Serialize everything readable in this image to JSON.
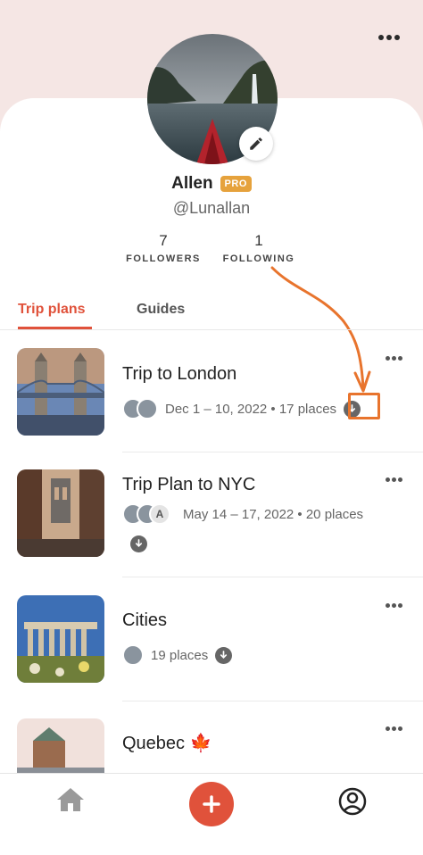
{
  "profile": {
    "name": "Allen",
    "badge": "PRO",
    "handle": "@Lunallan",
    "followers_count": "7",
    "followers_label": "FOLLOWERS",
    "following_count": "1",
    "following_label": "FOLLOWING"
  },
  "tabs": [
    {
      "label": "Trip plans",
      "active": true
    },
    {
      "label": "Guides",
      "active": false
    }
  ],
  "trips": [
    {
      "title": "Trip to London",
      "meta": "Dec 1 –  10, 2022 • 17 places"
    },
    {
      "title": "Trip Plan to NYC",
      "meta": "May 14 –  17, 2022 • 20 places",
      "avatar_letter": "A"
    },
    {
      "title": "Cities",
      "meta": "19 places"
    },
    {
      "title": "Quebec 🍁"
    }
  ],
  "colors": {
    "accent": "#e0523b",
    "pro_badge": "#e6a23c",
    "annotation": "#e8742d",
    "header_bg": "#f5e6e4"
  },
  "icons": [
    "more-horizontal-icon",
    "pencil-icon",
    "download-icon",
    "home-icon",
    "plus-icon",
    "profile-icon"
  ]
}
